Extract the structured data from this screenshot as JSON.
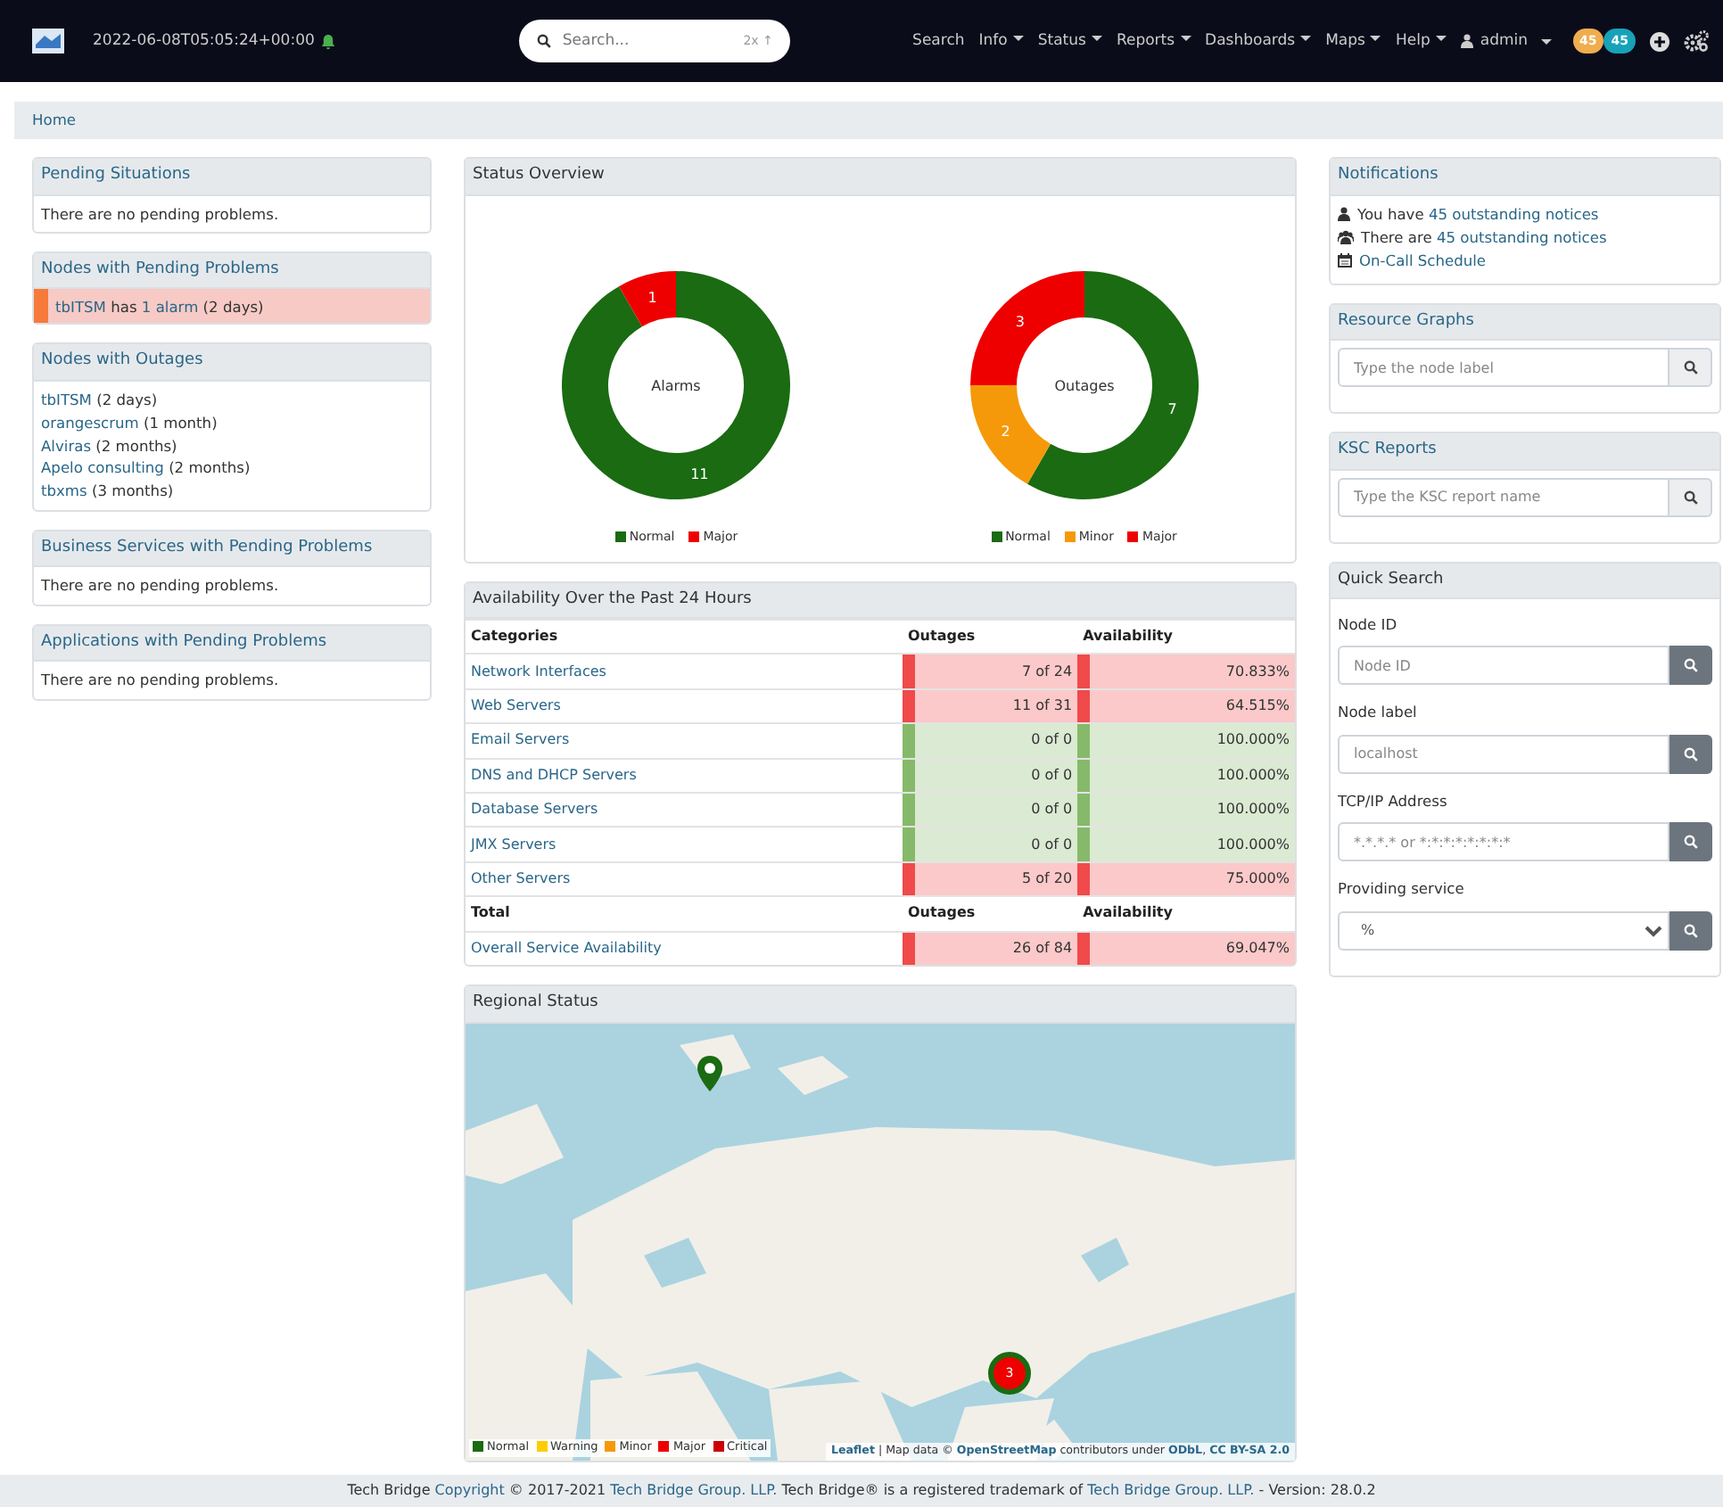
{
  "navbar": {
    "timestamp": "2022-06-08T05:05:24+00:00",
    "search": {
      "placeholder": "Search...",
      "hint": "2x ↑"
    },
    "menu": [
      {
        "label": "Search",
        "dropdown": false
      },
      {
        "label": "Info",
        "dropdown": true
      },
      {
        "label": "Status",
        "dropdown": true
      },
      {
        "label": "Reports",
        "dropdown": true
      },
      {
        "label": "Dashboards",
        "dropdown": true
      },
      {
        "label": "Maps",
        "dropdown": true
      },
      {
        "label": "Help",
        "dropdown": true
      }
    ],
    "user": {
      "label": "admin"
    },
    "badges": [
      {
        "text": "45",
        "color": "#f0ad4e"
      },
      {
        "text": "45",
        "color": "#17a2b8"
      }
    ]
  },
  "breadcrumb": [
    "Home"
  ],
  "left": [
    {
      "title": "Pending Situations",
      "kind": "message",
      "text": "There are no pending problems."
    },
    {
      "title": "Nodes with Pending Problems",
      "kind": "alarms",
      "items": [
        {
          "color": "#f77a3a",
          "parts": [
            {
              "text": "tbITSM",
              "link": true
            },
            {
              "text": " has ",
              "link": false
            },
            {
              "text": "1 alarm",
              "link": true
            },
            {
              "text": " (2 days)",
              "link": false
            }
          ]
        }
      ]
    },
    {
      "title": "Nodes with Outages",
      "kind": "outages",
      "items": [
        {
          "link": "tbITSM",
          "text": " (2 days)"
        },
        {
          "link": "orangescrum",
          "text": " (1 month)"
        },
        {
          "link": "Alviras",
          "text": " (2 months)"
        },
        {
          "link": "Apelo consulting",
          "text": " (2 months)"
        },
        {
          "link": "tbxms",
          "text": " (3 months)"
        }
      ]
    },
    {
      "title": "Business Services with Pending Problems",
      "kind": "message",
      "text": "There are no pending problems."
    },
    {
      "title": "Applications with Pending Problems",
      "kind": "message",
      "text": "There are no pending problems."
    }
  ],
  "status_overview": {
    "title": "Status Overview",
    "charts": [
      {
        "slices": [
          {
            "color": "#1a6b12"
          },
          {
            "color": "#ee0000"
          }
        ],
        "chart_data": {
          "type": "donut",
          "categories": [
            "Normal",
            "Major"
          ],
          "series": [
            {
              "name": "Alarms",
              "values": [
                11,
                1
              ]
            }
          ],
          "data_labels": true
        }
      },
      {
        "slices": [
          {
            "color": "#1a6b12"
          },
          {
            "color": "#f5990a"
          },
          {
            "color": "#ee0000"
          }
        ],
        "chart_data": {
          "type": "donut",
          "categories": [
            "Normal",
            "Minor",
            "Major"
          ],
          "series": [
            {
              "name": "Outages",
              "values": [
                7,
                2,
                3
              ]
            }
          ],
          "data_labels": true
        }
      }
    ]
  },
  "availability": {
    "title": "Availability Over the Past 24 Hours",
    "columns": [
      "Categories",
      "Outages",
      "Availability"
    ],
    "rows": [
      {
        "category": "Network Interfaces",
        "outages": "7 of 24",
        "availability": "70.833%",
        "color": "#f04a4a"
      },
      {
        "category": "Web Servers",
        "outages": "11 of 31",
        "availability": "64.515%",
        "color": "#f04a4a"
      },
      {
        "category": "Email Servers",
        "outages": "0 of 0",
        "availability": "100.000%",
        "color": "#86b96a"
      },
      {
        "category": "DNS and DHCP Servers",
        "outages": "0 of 0",
        "availability": "100.000%",
        "color": "#86b96a"
      },
      {
        "category": "Database Servers",
        "outages": "0 of 0",
        "availability": "100.000%",
        "color": "#86b96a"
      },
      {
        "category": "JMX Servers",
        "outages": "0 of 0",
        "availability": "100.000%",
        "color": "#86b96a"
      },
      {
        "category": "Other Servers",
        "outages": "5 of 20",
        "availability": "75.000%",
        "color": "#f04a4a"
      }
    ],
    "total_columns": [
      "Total",
      "Outages",
      "Availability"
    ],
    "total": {
      "category": "Overall Service Availability",
      "outages": "26 of 84",
      "availability": "69.047%",
      "color": "#f04a4a"
    }
  },
  "regional_status": {
    "title": "Regional Status",
    "markers": [
      {
        "kind": "pin",
        "color": "#1a6b12"
      },
      {
        "kind": "cluster",
        "count": "3",
        "color": "#ee0000"
      }
    ],
    "legend": [
      {
        "label": "Normal",
        "color": "#1a6b12"
      },
      {
        "label": "Warning",
        "color": "#ffcc00"
      },
      {
        "label": "Minor",
        "color": "#f5990a"
      },
      {
        "label": "Major",
        "color": "#ee0000"
      },
      {
        "label": "Critical",
        "color": "#cc0000"
      }
    ],
    "attribution": [
      {
        "text": "Leaflet",
        "link": true
      },
      {
        "text": " | Map data © ",
        "link": false
      },
      {
        "text": "OpenStreetMap",
        "link": true
      },
      {
        "text": " contributors under ",
        "link": false
      },
      {
        "text": "ODbL",
        "link": true
      },
      {
        "text": ", ",
        "link": false
      },
      {
        "text": "CC BY-SA 2.0",
        "link": true
      }
    ]
  },
  "right": {
    "notifications": {
      "title": "Notifications",
      "items": [
        {
          "kind": "user",
          "text": "You have ",
          "link": "45 outstanding notices"
        },
        {
          "kind": "group",
          "text": "There are ",
          "link": "45 outstanding notices"
        },
        {
          "kind": "schedule",
          "link": "On-Call Schedule"
        }
      ]
    },
    "resource_graphs": {
      "title": "Resource Graphs",
      "placeholder": "Type the node label"
    },
    "ksc_reports": {
      "title": "KSC Reports",
      "placeholder": "Type the KSC report name"
    },
    "quick_search": {
      "title": "Quick Search",
      "fields": [
        {
          "label": "Node ID",
          "kind": "input",
          "placeholder": "Node ID"
        },
        {
          "label": "Node label",
          "kind": "input",
          "placeholder": "localhost"
        },
        {
          "label": "TCP/IP Address",
          "kind": "input",
          "placeholder": "*.*.*.* or *:*:*:*:*:*:*:*"
        },
        {
          "label": "Providing service",
          "kind": "select",
          "value": "%"
        }
      ]
    }
  },
  "footer": [
    {
      "text": "Tech Bridge ",
      "link": false
    },
    {
      "text": "Copyright",
      "link": true
    },
    {
      "text": " © 2017-2021 ",
      "link": false
    },
    {
      "text": "Tech Bridge Group. LLP.",
      "link": true
    },
    {
      "text": " Tech Bridge® is a registered trademark of ",
      "link": false
    },
    {
      "text": "Tech Bridge Group. LLP.",
      "link": true
    },
    {
      "text": " - Version: 28.0.2",
      "link": false
    }
  ]
}
